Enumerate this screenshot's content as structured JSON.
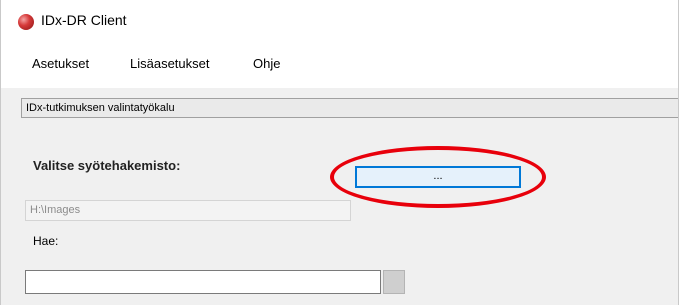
{
  "window": {
    "title": "IDx-DR Client",
    "icon": "app-red-circle-icon"
  },
  "menu": {
    "items": [
      {
        "label": "Asetukset"
      },
      {
        "label": "Lisäasetukset"
      },
      {
        "label": "Ohje"
      }
    ]
  },
  "tool": {
    "header": "IDx-tutkimuksen valintatyökalu",
    "input_dir_label": "Valitse syötehakemisto:",
    "browse_button_label": "...",
    "input_dir_value": "H:\\Images",
    "search_label": "Hae:",
    "search_value": ""
  },
  "colors": {
    "highlight": "#e8000b",
    "button_focus_border": "#0078d7",
    "button_fill": "#e5f1fb",
    "panel_background": "#f0f0f0"
  }
}
